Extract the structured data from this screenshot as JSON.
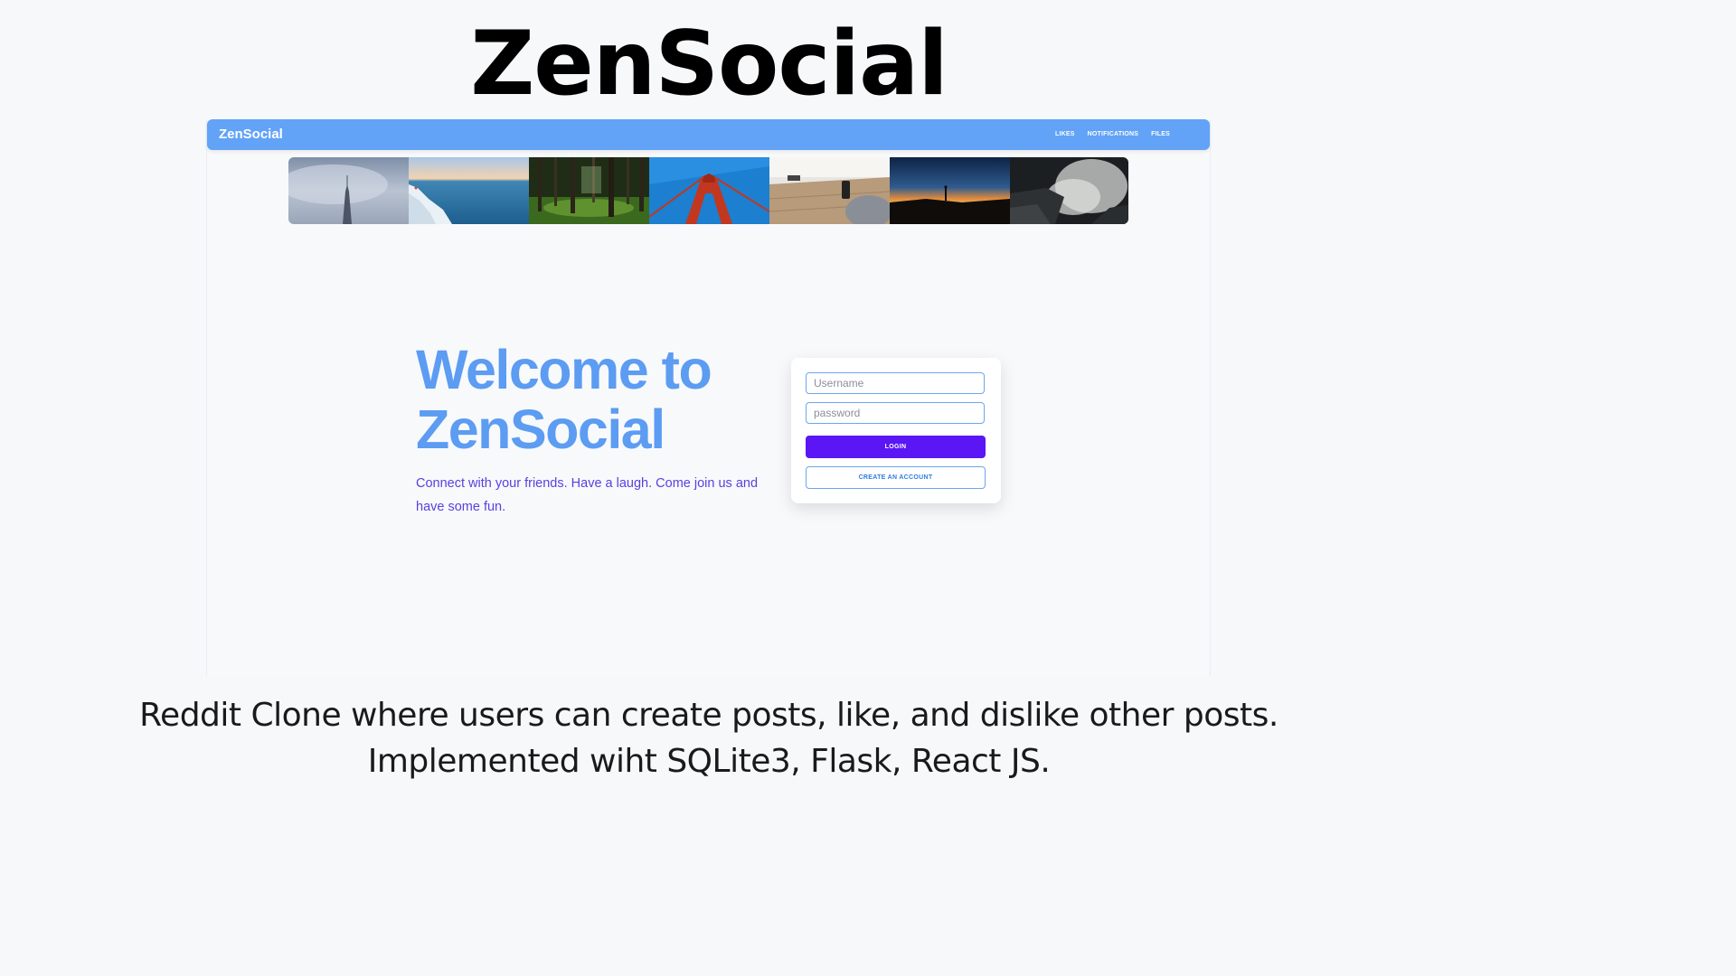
{
  "hero": {
    "title": "ZenSocial"
  },
  "navbar": {
    "brand": "ZenSocial",
    "links": [
      "LIKES",
      "NOTIFICATIONS",
      "FILES"
    ]
  },
  "colors": {
    "navbar": "#62a3f7",
    "welcome_title": "#5c9cf2",
    "welcome_sub": "#5a3fe0",
    "login_button": "#5b16f5"
  },
  "welcome": {
    "title_line1": "Welcome to",
    "title_line2": "ZenSocial",
    "subtitle": "Connect with your friends. Have a laugh. Come join us and have some fun."
  },
  "login": {
    "username_placeholder": "Username",
    "password_placeholder": "password",
    "login_label": "LOGIN",
    "create_label": "CREATE AN ACCOUNT"
  },
  "caption": {
    "line1": "Reddit Clone where users can create posts, like, and dislike other posts.",
    "line2": "Implemented wiht SQLite3, Flask, React JS."
  }
}
